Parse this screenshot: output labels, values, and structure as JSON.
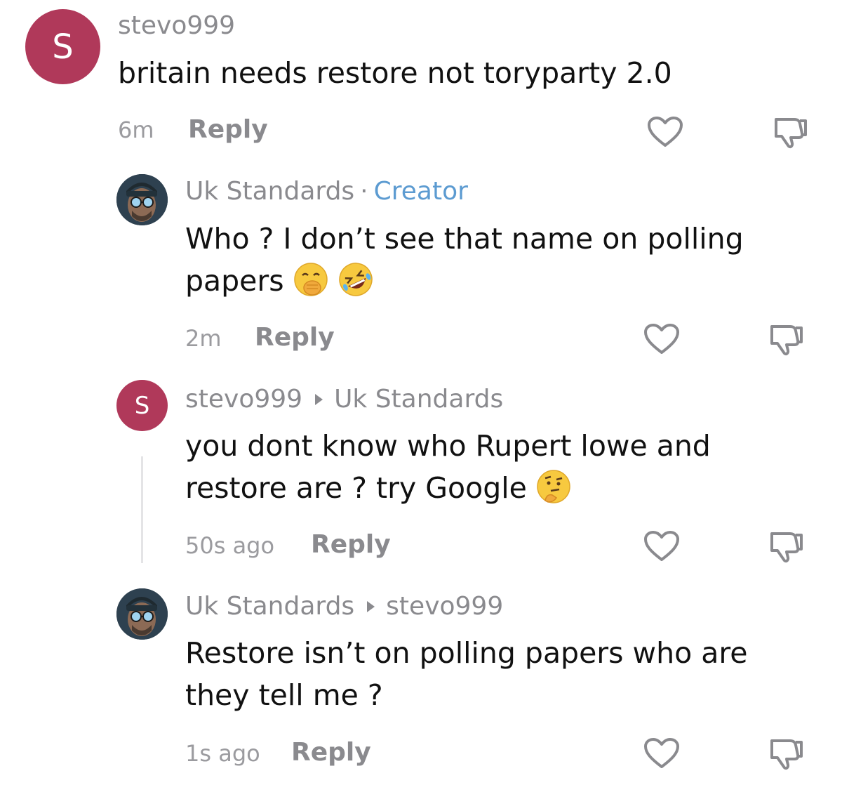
{
  "comments": [
    {
      "username": "stevo999",
      "avatar_letter": "S",
      "text_lines": [
        "britain needs restore not toryparty 2.0"
      ],
      "time": "6m",
      "reply_label": "Reply"
    },
    {
      "username": "Uk Standards",
      "separator": "·",
      "badge": "Creator",
      "text_lines": [
        "Who ? I don’t see that name on polling",
        "papers"
      ],
      "emojis": [
        "face-with-hand-over-mouth",
        "rolling-on-floor-laughing"
      ],
      "time": "2m",
      "reply_label": "Reply"
    },
    {
      "username": "stevo999",
      "reply_to": "Uk Standards",
      "avatar_letter": "S",
      "text_lines": [
        "you dont know who Rupert lowe and",
        "restore are ? try Google"
      ],
      "emojis": [
        "thinking-face"
      ],
      "time": "50s ago",
      "reply_label": "Reply"
    },
    {
      "username": "Uk Standards",
      "reply_to": "stevo999",
      "text_lines": [
        "Restore isn’t on polling papers who are",
        "they tell me ?"
      ],
      "time": "1s ago",
      "reply_label": "Reply"
    }
  ],
  "icons": {
    "like": "heart-icon",
    "dislike": "thumbs-down-icon"
  },
  "colors": {
    "avatar_bg": "#b0395a",
    "creator_badge": "#5c9bd1",
    "muted_text": "#8a8a8e"
  }
}
